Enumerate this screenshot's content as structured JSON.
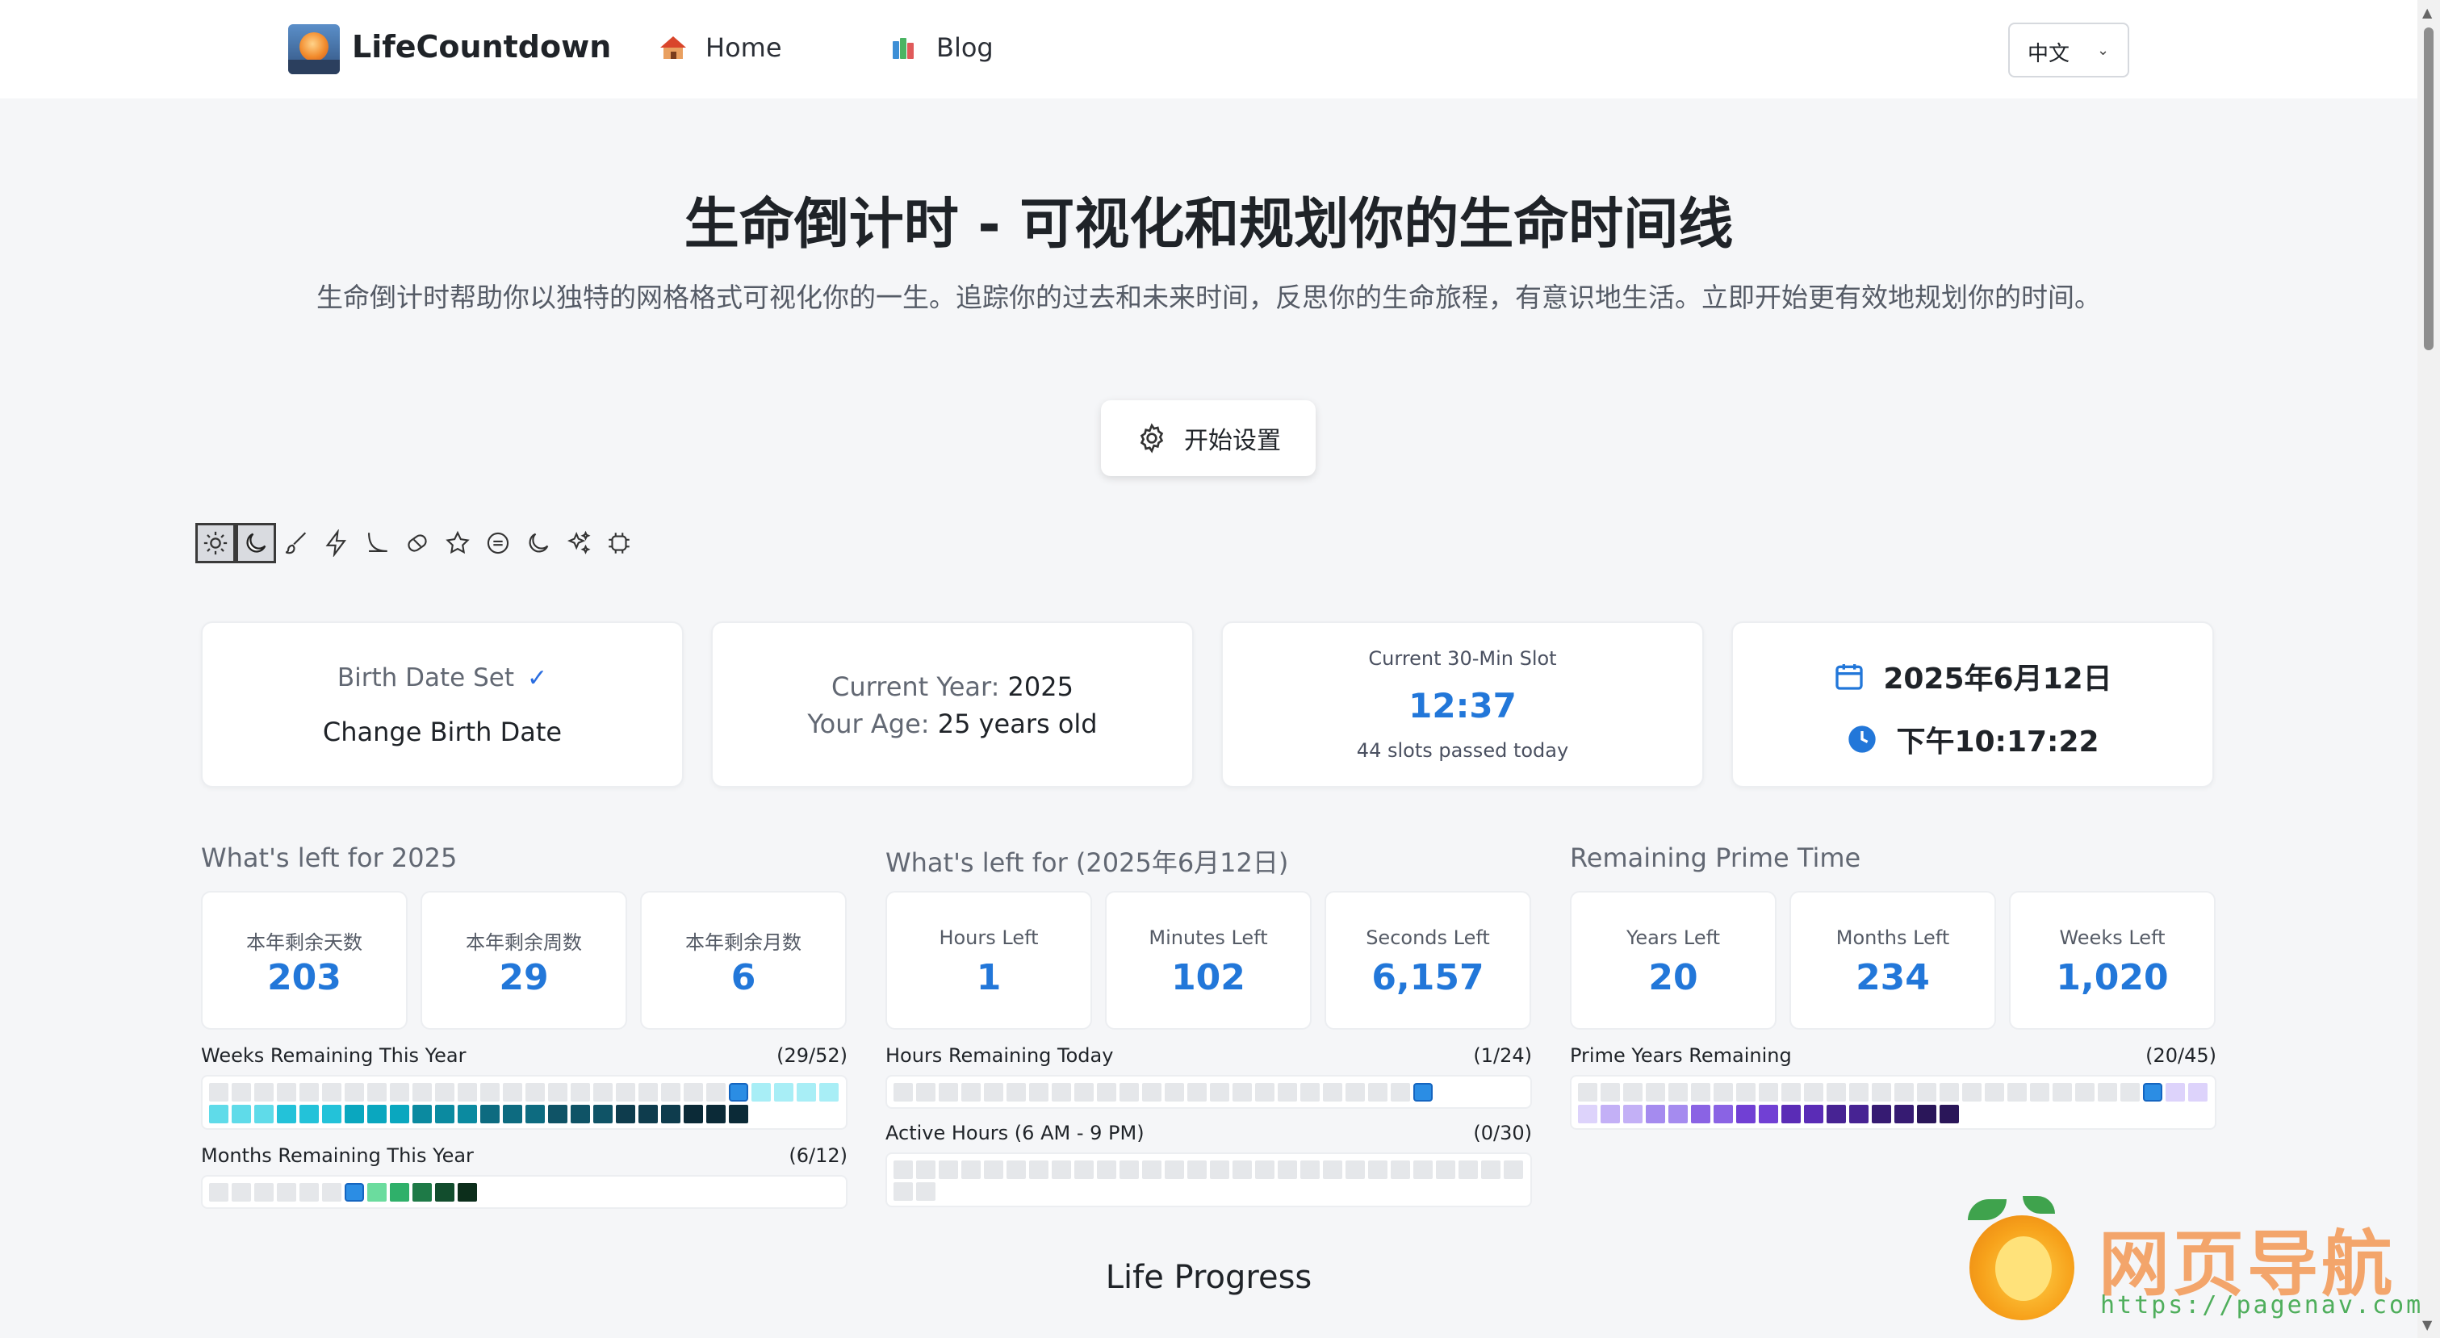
{
  "nav": {
    "brand": "LifeCountdown",
    "links": [
      {
        "label": "Home",
        "icon": "house-icon"
      },
      {
        "label": "Blog",
        "icon": "books-icon"
      }
    ],
    "language": "中文"
  },
  "hero": {
    "title": "生命倒计时 - 可视化和规划你的生命时间线",
    "subtitle": "生命倒计时帮助你以独特的网格格式可视化你的一生。追踪你的过去和未来时间，反思你的生命旅程，有意识地生活。立即开始更有效地规划你的时间。",
    "setup_button": "开始设置"
  },
  "themes": [
    "sun-icon",
    "moon-icon",
    "brush-icon",
    "bolt-icon",
    "curve-icon",
    "eraser-icon",
    "star-icon",
    "circle-minus-icon",
    "crescent-icon",
    "sparkles-icon",
    "chip-icon"
  ],
  "cards": {
    "birth": {
      "status": "Birth Date Set",
      "check": "✓",
      "action": "Change Birth Date"
    },
    "year": {
      "year_label": "Current Year:",
      "year": "2025",
      "age_label": "Your Age:",
      "age": "25 years old"
    },
    "slot": {
      "label": "Current 30-Min Slot",
      "time": "12:37",
      "passed": "44 slots passed today"
    },
    "clock": {
      "date": "2025年6月12日",
      "time": "下午10:17:22"
    }
  },
  "sections": {
    "year": {
      "title": "What's left for 2025",
      "stats": [
        {
          "label": "本年剩余天数",
          "value": "203"
        },
        {
          "label": "本年剩余周数",
          "value": "29"
        },
        {
          "label": "本年剩余月数",
          "value": "6"
        }
      ],
      "grids": [
        {
          "label": "Weeks Remaining This Year",
          "count": "(29/52)"
        },
        {
          "label": "Months Remaining This Year",
          "count": "(6/12)"
        }
      ]
    },
    "day": {
      "title": "What's left for (2025年6月12日)",
      "stats": [
        {
          "label": "Hours Left",
          "value": "1"
        },
        {
          "label": "Minutes Left",
          "value": "102"
        },
        {
          "label": "Seconds Left",
          "value": "6,157"
        }
      ],
      "grids": [
        {
          "label": "Hours Remaining Today",
          "count": "(1/24)"
        },
        {
          "label": "Active Hours (6 AM - 9 PM)",
          "count": "(0/30)"
        }
      ]
    },
    "prime": {
      "title": "Remaining Prime Time",
      "stats": [
        {
          "label": "Years Left",
          "value": "20"
        },
        {
          "label": "Months Left",
          "value": "234"
        },
        {
          "label": "Weeks Left",
          "value": "1,020"
        }
      ],
      "grids": [
        {
          "label": "Prime Years Remaining",
          "count": "(20/45)"
        }
      ]
    }
  },
  "life_progress": "Life Progress",
  "watermark": {
    "name": "网页导航",
    "url": "https://pagenav.com"
  },
  "colors": {
    "accent": "#2277d9",
    "current_cell": "#2b8de4",
    "empty_cell": "#e5e7ea",
    "weeks_palette": [
      "#a8eef6",
      "#5fdbe9",
      "#23c2d9",
      "#0aa7bf",
      "#0b8aa0",
      "#0d6b80",
      "#0f5366",
      "#0e3c4d",
      "#0b2a37"
    ],
    "months_palette": [
      "#6bdc9e",
      "#2fb06a",
      "#1e7a47",
      "#124d2d",
      "#0c2e1b"
    ],
    "hours_palette": [
      "#4a1e0a"
    ],
    "prime_palette": [
      "#ddd3fb",
      "#c3b0f6",
      "#a58bef",
      "#8a63e4",
      "#7140d4",
      "#5a2cb6",
      "#472393",
      "#361b72",
      "#2a1659"
    ]
  }
}
